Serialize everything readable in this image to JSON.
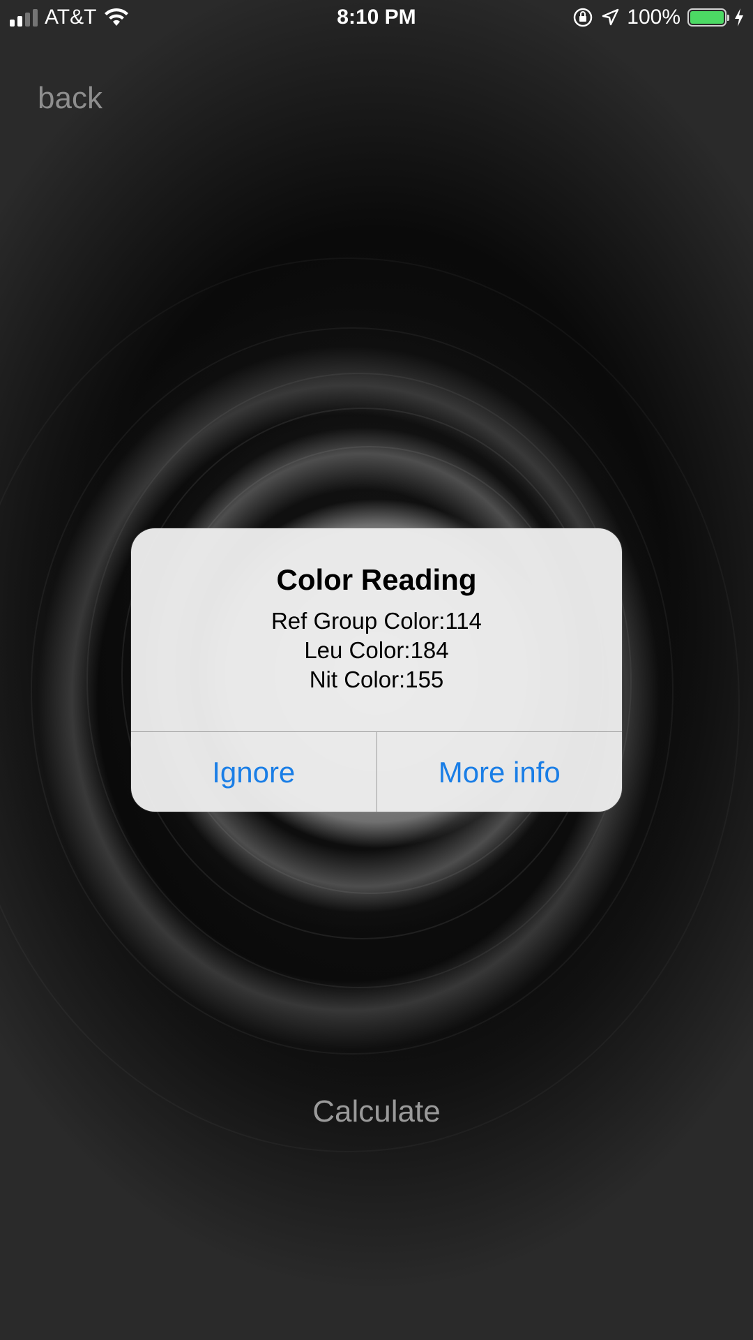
{
  "status_bar": {
    "carrier": "AT&T",
    "time": "8:10 PM",
    "battery_percent": "100%",
    "signal_bars": 2,
    "battery_level": 1.0,
    "icons": [
      "signal-icon",
      "wifi-icon",
      "rotation-lock-icon",
      "location-icon",
      "battery-icon",
      "charging-bolt-icon"
    ]
  },
  "nav": {
    "back_label": "back"
  },
  "alert": {
    "title": "Color Reading",
    "lines": [
      "Ref Group Color:114",
      "Leu Color:184",
      "Nit Color:155"
    ],
    "buttons": {
      "ignore": "Ignore",
      "more_info": "More info"
    }
  },
  "calculate_label": "Calculate",
  "colors": {
    "accent": "#1a7ee6",
    "battery": "#4cd964"
  }
}
